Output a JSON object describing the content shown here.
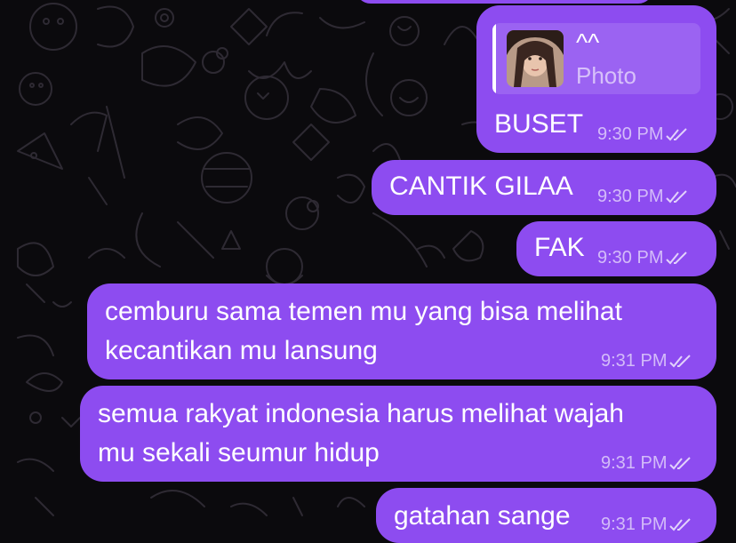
{
  "theme": {
    "bubble_color": "#8d4cf0",
    "background": "#0b0a0d"
  },
  "messages": [
    {
      "id": "m1",
      "reply": {
        "title": "^^",
        "subtitle": "Photo"
      },
      "text": "BUSET",
      "time": "9:30 PM",
      "status": "read-double-check-icon"
    },
    {
      "id": "m2",
      "text": "CANTIK GILAA",
      "time": "9:30 PM",
      "status": "read-double-check-icon"
    },
    {
      "id": "m3",
      "text": "FAK",
      "time": "9:30 PM",
      "status": "read-double-check-icon"
    },
    {
      "id": "m4",
      "line1": "cemburu sama temen mu yang bisa melihat",
      "line2": "kecantikan mu lansung",
      "time": "9:31 PM",
      "status": "read-double-check-icon"
    },
    {
      "id": "m5",
      "line1": "semua rakyat indonesia harus melihat wajah",
      "line2": "mu sekali seumur hidup",
      "time": "9:31 PM",
      "status": "read-double-check-icon"
    },
    {
      "id": "m6",
      "text": "gatahan sange",
      "time": "9:31 PM",
      "status": "read-double-check-icon"
    }
  ]
}
